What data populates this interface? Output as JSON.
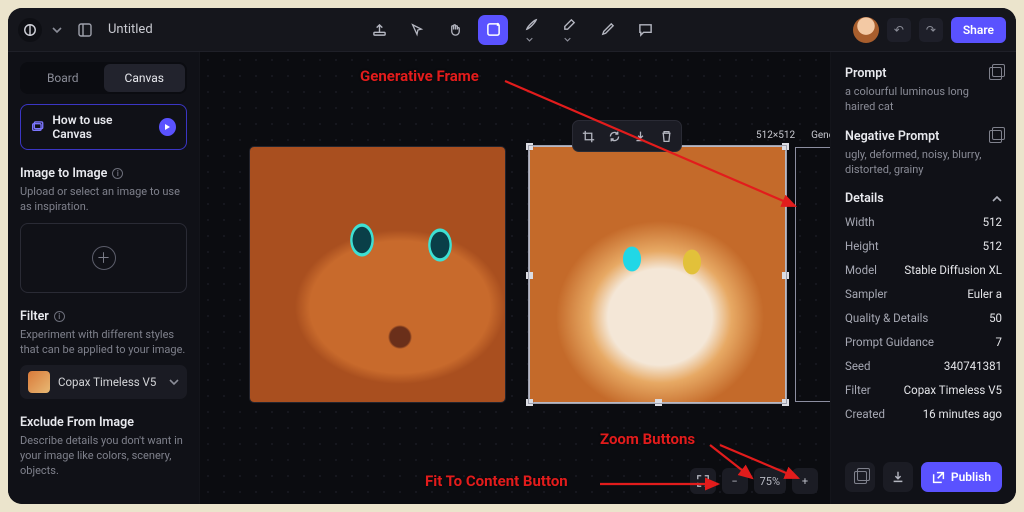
{
  "header": {
    "title": "Untitled",
    "share": "Share"
  },
  "tabs": {
    "board": "Board",
    "canvas": "Canvas"
  },
  "howto": {
    "label": "How to use Canvas"
  },
  "left": {
    "img2img_h": "Image to Image",
    "img2img_sub": "Upload or select an image to use as inspiration.",
    "filter_h": "Filter",
    "filter_sub": "Experiment with different styles that can be applied to your image.",
    "filter_value": "Copax Timeless V5",
    "exclude_h": "Exclude From Image",
    "exclude_sub": "Describe details you don't want in your image like colors, scenery, objects."
  },
  "canvas": {
    "size_label": "512×512",
    "gen_label": "Generati",
    "zoom": "75%"
  },
  "annotations": {
    "gen_frame": "Generative Frame",
    "zoom_buttons": "Zoom Buttons",
    "fit_button": "Fit To Content Button"
  },
  "right": {
    "prompt_h": "Prompt",
    "prompt_v": "a colourful luminous long haired cat",
    "neg_h": "Negative Prompt",
    "neg_v": "ugly, deformed, noisy, blurry, distorted, grainy",
    "details_h": "Details",
    "rows": {
      "width_l": "Width",
      "width_v": "512",
      "height_l": "Height",
      "height_v": "512",
      "model_l": "Model",
      "model_v": "Stable Diffusion XL",
      "sampler_l": "Sampler",
      "sampler_v": "Euler a",
      "quality_l": "Quality & Details",
      "quality_v": "50",
      "guidance_l": "Prompt Guidance",
      "guidance_v": "7",
      "seed_l": "Seed",
      "seed_v": "340741381",
      "filter_l": "Filter",
      "filter_v": "Copax Timeless V5",
      "created_l": "Created",
      "created_v": "16 minutes ago"
    },
    "publish": "Publish"
  }
}
